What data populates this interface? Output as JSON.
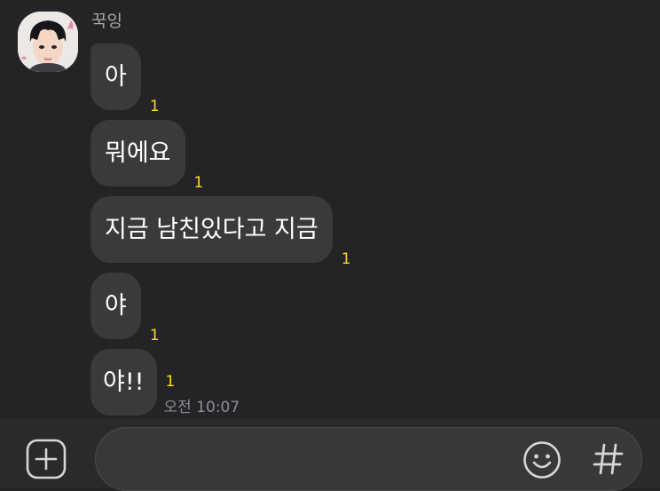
{
  "chat": {
    "sender_name": "꾹잉",
    "messages": [
      {
        "text": "아",
        "unread": "1"
      },
      {
        "text": "뭐에요",
        "unread": "1"
      },
      {
        "text": "지금 남친있다고 지금",
        "unread": "1"
      },
      {
        "text": "야",
        "unread": "1"
      },
      {
        "text": "야!!",
        "unread": "1",
        "time": "오전 10:07"
      }
    ]
  },
  "input": {
    "placeholder": ""
  },
  "icons": {
    "add": "plus-square-icon",
    "emoji": "smiley-icon",
    "hashtag": "hash-icon"
  },
  "colors": {
    "background": "#242427",
    "bubble": "#3a3a3c",
    "unread": "#ffd81f"
  }
}
